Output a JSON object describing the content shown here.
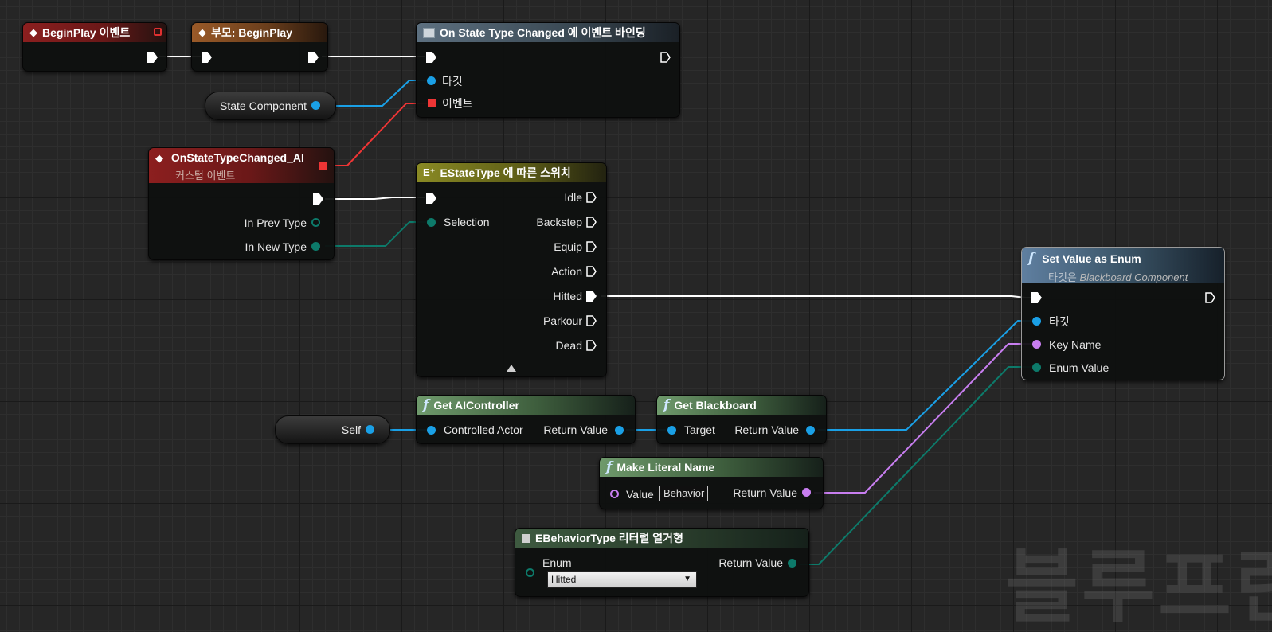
{
  "colors": {
    "exec": "#ffffff",
    "object": "#1aa0e6",
    "delegate": "#ee3535",
    "enum": "#0d7a6a",
    "name": "#c87ef0",
    "background": "#262626"
  },
  "watermark": "블루프린",
  "nodes": {
    "beginplay": {
      "title": "BeginPlay 이벤트"
    },
    "parent_beginplay": {
      "title": "부모: BeginPlay"
    },
    "bind_event": {
      "title": "On State Type Changed 에 이벤트 바인딩",
      "pins": {
        "target": "타깃",
        "event": "이벤트"
      }
    },
    "state_component": {
      "label": "State Component"
    },
    "custom_event": {
      "title": "OnStateTypeChanged_AI",
      "subtitle": "커스텀 이벤트",
      "pins": {
        "prev": "In Prev Type",
        "new": "In New Type"
      }
    },
    "switch": {
      "title": "EStateType 에 따른 스위치",
      "selection": "Selection",
      "outputs": [
        "Idle",
        "Backstep",
        "Equip",
        "Action",
        "Hitted",
        "Parkour",
        "Dead"
      ]
    },
    "set_value": {
      "title": "Set Value as Enum",
      "subtitle_prefix": "타깃은 ",
      "subtitle_target": "Blackboard Component",
      "pins": {
        "target": "타깃",
        "key": "Key Name",
        "enum": "Enum Value"
      }
    },
    "self": {
      "label": "Self"
    },
    "get_ai": {
      "title": "Get AIController",
      "pins": {
        "in": "Controlled Actor",
        "out": "Return Value"
      }
    },
    "get_bb": {
      "title": "Get Blackboard",
      "pins": {
        "in": "Target",
        "out": "Return Value"
      }
    },
    "literal_name": {
      "title": "Make Literal Name",
      "pins": {
        "in": "Value",
        "value": "Behavior",
        "out": "Return Value"
      }
    },
    "enum_literal": {
      "title": "EBehaviorType 리터럴 열거형",
      "pins": {
        "in": "Enum",
        "value": "Hitted",
        "out": "Return Value"
      }
    }
  }
}
